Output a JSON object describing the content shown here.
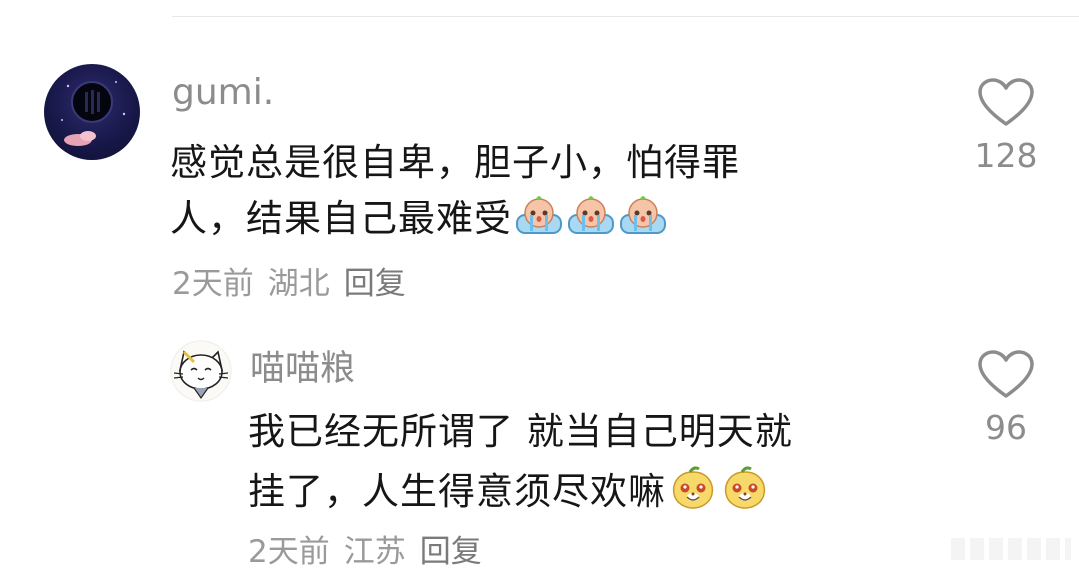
{
  "comments": [
    {
      "username": "gumi.",
      "text_line1": "感觉总是很自卑，胆子小，怕得罪",
      "text_line2": "人，结果自己最难受",
      "emoji": "crying-baby-emoji",
      "emoji_count": 3,
      "time": "2天前",
      "location": "湖北",
      "reply_label": "回复",
      "like_count": "128",
      "avatar": "dark-night-sky-avatar"
    },
    {
      "username": "喵喵粮",
      "text_line1": "我已经无所谓了 就当自己明天就",
      "text_line2": "挂了，人生得意须尽欢嘛",
      "emoji": "happy-mango-emoji",
      "emoji_count": 2,
      "time": "2天前",
      "location": "江苏",
      "reply_label": "回复",
      "like_count": "96",
      "avatar": "cartoon-cat-avatar"
    }
  ],
  "colors": {
    "text": "#161616",
    "username": "#8c8c8c",
    "meta": "#9a9a9a",
    "icon": "#8c8c8c"
  }
}
